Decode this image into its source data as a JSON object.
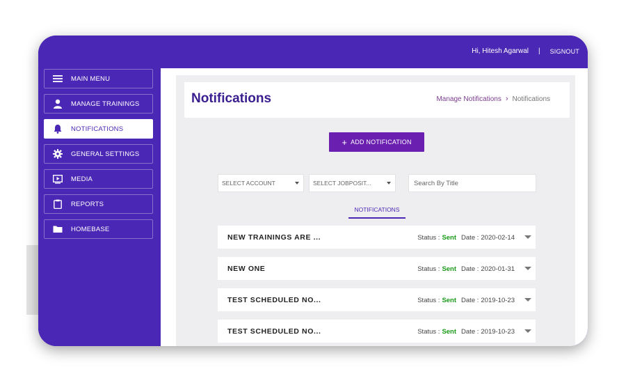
{
  "topbar": {
    "greeting": "Hi, Hitesh Agarwal",
    "separator": "|",
    "signout": "SIGNOUT"
  },
  "sidebar": {
    "items": [
      {
        "label": "MAIN MENU",
        "icon": "menu-icon",
        "active": false
      },
      {
        "label": "MANAGE TRAININGS",
        "icon": "user-icon",
        "active": false
      },
      {
        "label": "NOTIFICATIONS",
        "icon": "bell-icon",
        "active": true
      },
      {
        "label": "GENERAL SETTINGS",
        "icon": "gear-icon",
        "active": false
      },
      {
        "label": "MEDIA",
        "icon": "play-icon",
        "active": false
      },
      {
        "label": "REPORTS",
        "icon": "clipboard-icon",
        "active": false
      },
      {
        "label": "HOMEBASE",
        "icon": "folder-icon",
        "active": false
      }
    ]
  },
  "header": {
    "title": "Notifications",
    "breadcrumb": {
      "link": "Manage Notifications",
      "current": "Notifications"
    }
  },
  "add_button": {
    "label": "ADD NOTIFICATION"
  },
  "filters": {
    "account": "SELECT ACCOUNT",
    "jobposition": "SELECT JOBPOSIT...",
    "search_placeholder": "Search By Title"
  },
  "tab": {
    "label": "NOTIFICATIONS"
  },
  "status_label": "Status :",
  "date_label": "Date :",
  "notifications": [
    {
      "title": "NEW TRAININGS ARE ...",
      "status": "Sent",
      "date": "2020-02-14"
    },
    {
      "title": "NEW ONE",
      "status": "Sent",
      "date": "2020-01-31"
    },
    {
      "title": "TEST SCHEDULED NO...",
      "status": "Sent",
      "date": "2019-10-23"
    },
    {
      "title": "TEST SCHEDULED NO...",
      "status": "Sent",
      "date": "2019-10-23"
    }
  ],
  "colors": {
    "brand": "#4a27b4",
    "button": "#6a1fb0",
    "sent": "#1a9a1a"
  }
}
